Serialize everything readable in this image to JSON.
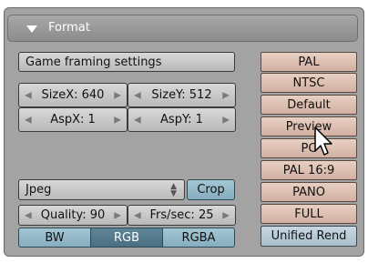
{
  "panel": {
    "title": "Format"
  },
  "left": {
    "game_framing": "Game framing settings",
    "size_x": "SizeX: 640",
    "size_y": "SizeY: 512",
    "asp_x": "AspX: 1",
    "asp_y": "AspY: 1",
    "format_select": "Jpeg",
    "crop": "Crop",
    "quality": "Quality: 90",
    "frs_sec": "Frs/sec: 25",
    "color_modes": [
      "BW",
      "RGB",
      "RGBA"
    ],
    "active_color_mode": "RGB"
  },
  "presets": [
    "PAL",
    "NTSC",
    "Default",
    "Preview",
    "PC",
    "PAL 16:9",
    "PANO",
    "FULL",
    "Unified Rend"
  ],
  "colors": {
    "panel_bg": "#a3a3a3",
    "preset_bg": "#d6b8a9",
    "teal_toggle": "#8fb4c3",
    "active_segment": "#557b8f"
  }
}
